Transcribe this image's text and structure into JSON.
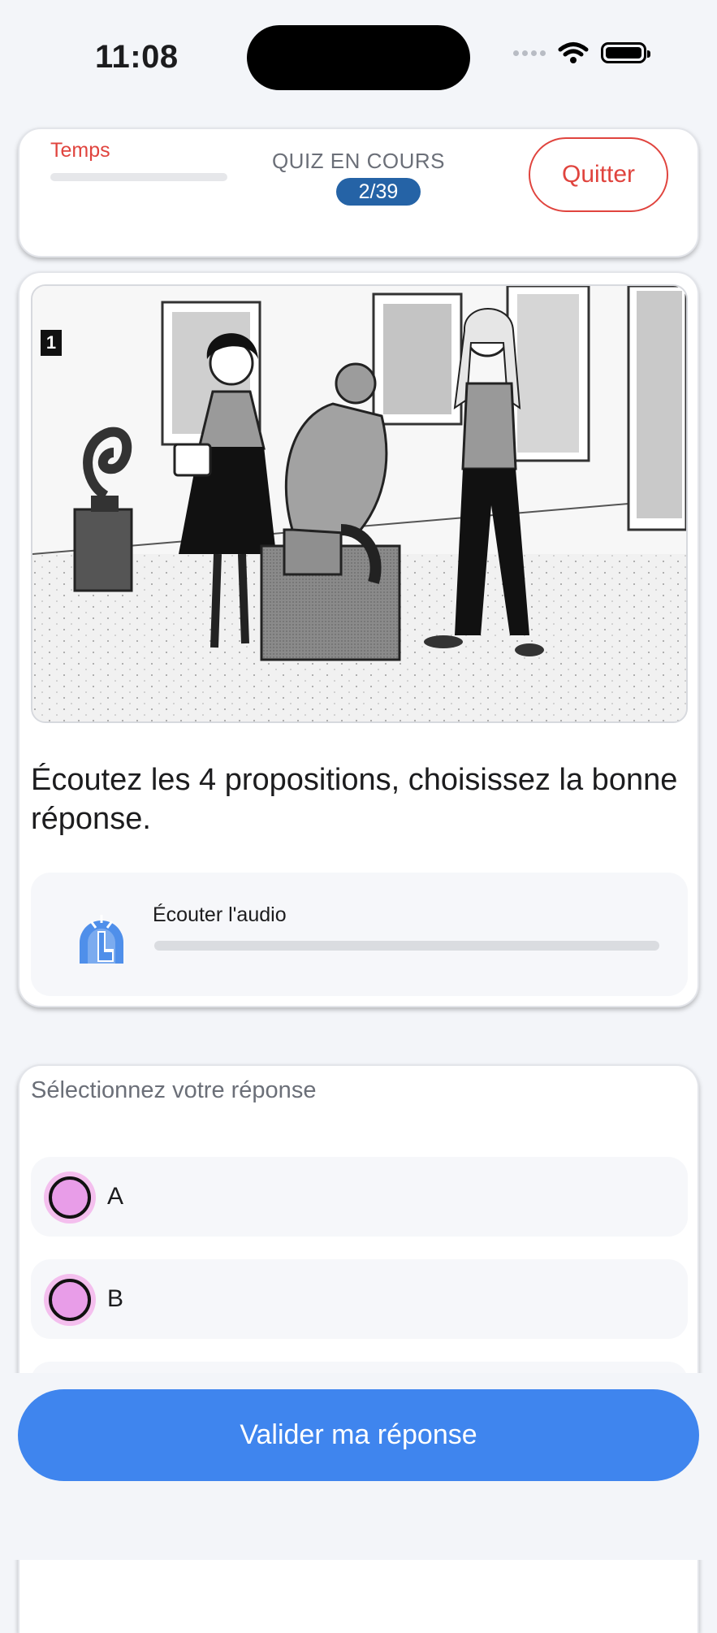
{
  "status_bar": {
    "time": "11:08"
  },
  "header": {
    "timer_label": "Temps",
    "quiz_status": "QUIZ EN COURS",
    "progress": "2/39",
    "quit_label": "Quitter"
  },
  "question": {
    "illustration_number": "1",
    "prompt": "Écoutez les 4 propositions, choisissez la bonne réponse.",
    "audio_label": "Écouter l'audio",
    "audio_progress": 0
  },
  "answers": {
    "title": "Sélectionnez votre réponse",
    "options": [
      {
        "label": "A"
      },
      {
        "label": "B"
      }
    ]
  },
  "footer": {
    "submit_label": "Valider ma réponse"
  },
  "colors": {
    "accent": "#3f85ee",
    "danger": "#e0443e",
    "pill": "#2563a6",
    "radio": "#e89de8"
  }
}
